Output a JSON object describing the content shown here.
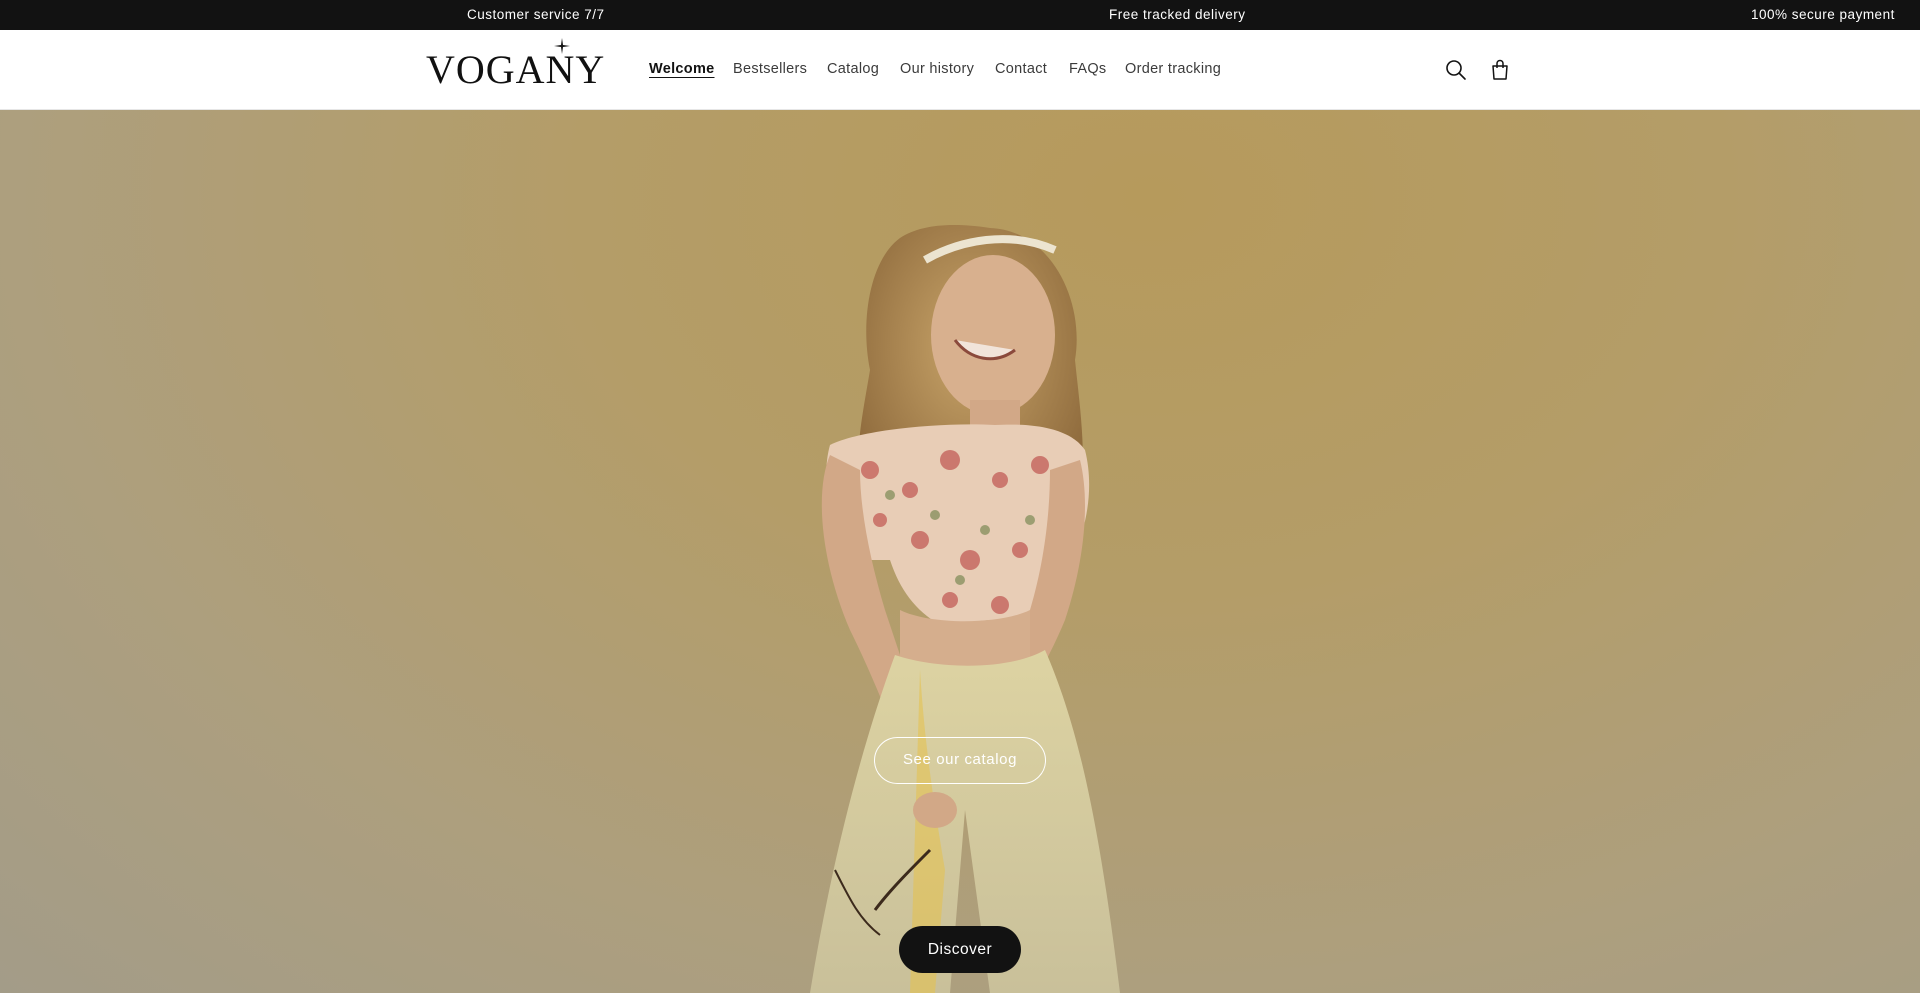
{
  "announcement": {
    "items": [
      "Customer service 7/7",
      "Free tracked delivery",
      "100% secure payment"
    ]
  },
  "header": {
    "logo_text": "VOGANY",
    "nav": [
      {
        "label": "Welcome",
        "active": true
      },
      {
        "label": "Bestsellers",
        "active": false
      },
      {
        "label": "Catalog",
        "active": false
      },
      {
        "label": "Our history",
        "active": false
      },
      {
        "label": "Contact",
        "active": false
      },
      {
        "label": "FAQs",
        "active": false
      },
      {
        "label": "Order tracking",
        "active": false
      }
    ],
    "icons": [
      "search-icon",
      "shopping-bag-icon"
    ]
  },
  "hero": {
    "cta_secondary": "See our catalog",
    "cta_primary": "Discover"
  },
  "colors": {
    "announcement_bg": "#121212",
    "hero_bg": "#b49d68",
    "button_dark": "#121212",
    "text": "#121212"
  }
}
